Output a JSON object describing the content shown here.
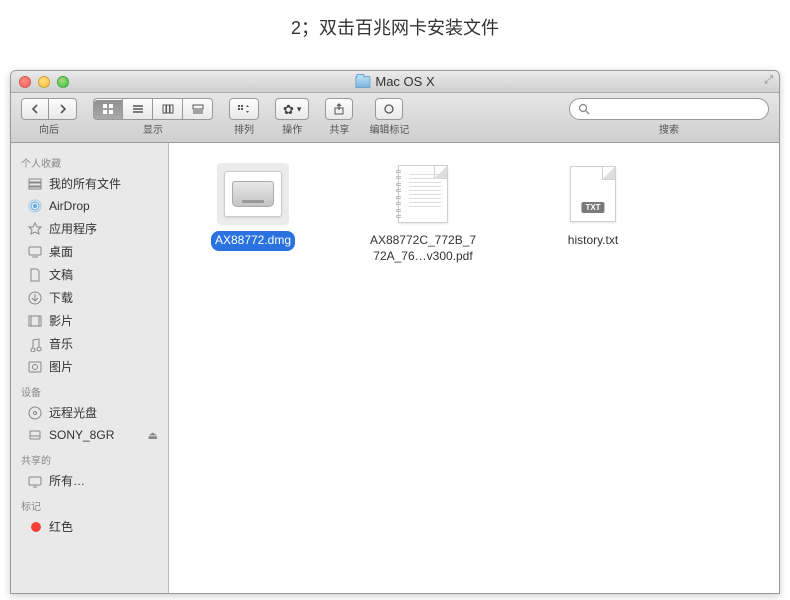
{
  "caption": "2；双击百兆网卡安装文件",
  "window": {
    "title": "Mac OS X",
    "expand_glyph": "⤢"
  },
  "toolbar": {
    "nav": {
      "label": "向后"
    },
    "view": {
      "label": "显示"
    },
    "arrange": {
      "label": "排列"
    },
    "action": {
      "label": "操作"
    },
    "share": {
      "label": "共享"
    },
    "tags": {
      "label": "编辑标记"
    },
    "search": {
      "label": "搜索"
    }
  },
  "sidebar": {
    "sections": [
      {
        "title": "个人收藏",
        "items": [
          {
            "name": "all-my-files",
            "label": "我的所有文件"
          },
          {
            "name": "airdrop",
            "label": "AirDrop"
          },
          {
            "name": "applications",
            "label": "应用程序"
          },
          {
            "name": "desktop",
            "label": "桌面"
          },
          {
            "name": "documents",
            "label": "文稿"
          },
          {
            "name": "downloads",
            "label": "下载"
          },
          {
            "name": "movies",
            "label": "影片"
          },
          {
            "name": "music",
            "label": "音乐"
          },
          {
            "name": "pictures",
            "label": "图片"
          }
        ]
      },
      {
        "title": "设备",
        "items": [
          {
            "name": "remote-disc",
            "label": "远程光盘"
          },
          {
            "name": "sony-8gr",
            "label": "SONY_8GR",
            "ejectable": true
          }
        ]
      },
      {
        "title": "共享的",
        "items": [
          {
            "name": "all-shared",
            "label": "所有…"
          }
        ]
      },
      {
        "title": "标记",
        "items": [
          {
            "name": "tag-red",
            "label": "红色",
            "color": "#f44336"
          }
        ]
      }
    ]
  },
  "files": [
    {
      "name": "dmg-file",
      "label": "AX88772.dmg",
      "type": "dmg",
      "selected": true
    },
    {
      "name": "pdf-file",
      "label": "AX88772C_772B_772A_76…v300.pdf",
      "type": "pdf",
      "selected": false
    },
    {
      "name": "txt-file",
      "label": "history.txt",
      "type": "txt",
      "selected": false,
      "badge": "TXT"
    }
  ]
}
